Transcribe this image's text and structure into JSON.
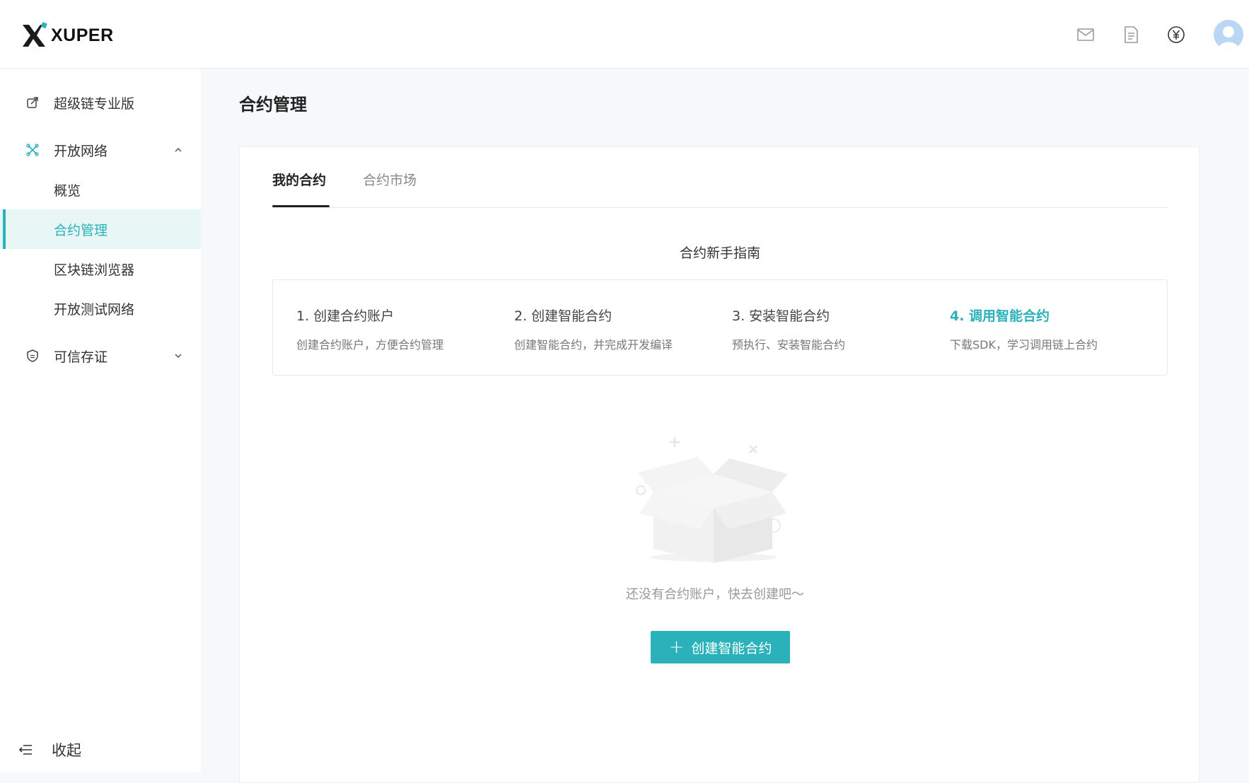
{
  "header": {
    "brand": "XUPER",
    "icons": [
      "mail-icon",
      "document-icon",
      "yen-icon",
      "avatar"
    ]
  },
  "sidebar": {
    "items": [
      {
        "label": "超级链专业版",
        "icon": "external-link-icon"
      },
      {
        "label": "开放网络",
        "icon": "network-icon",
        "expanded": true
      },
      {
        "label": "概览"
      },
      {
        "label": "合约管理",
        "active": true
      },
      {
        "label": "区块链浏览器"
      },
      {
        "label": "开放测试网络"
      },
      {
        "label": "可信存证",
        "icon": "shield-icon",
        "expanded": false
      }
    ],
    "collapse_label": "收起"
  },
  "main": {
    "page_title": "合约管理",
    "tabs": [
      {
        "label": "我的合约",
        "active": true
      },
      {
        "label": "合约市场",
        "active": false
      }
    ],
    "guide_title": "合约新手指南",
    "steps": [
      {
        "title": "1. 创建合约账户",
        "desc": "创建合约账户，方便合约管理"
      },
      {
        "title": "2. 创建智能合约",
        "desc": "创建智能合约，并完成开发编译"
      },
      {
        "title": "3. 安装智能合约",
        "desc": "预执行、安装智能合约"
      },
      {
        "title": "4. 调用智能合约",
        "desc": "下载SDK，学习调用链上合约",
        "highlight": true
      }
    ],
    "empty_text": "还没有合约账户，快去创建吧～",
    "create_button": "创建智能合约"
  },
  "colors": {
    "accent": "#2ab1ba",
    "active_bg": "#e8f6f6"
  }
}
